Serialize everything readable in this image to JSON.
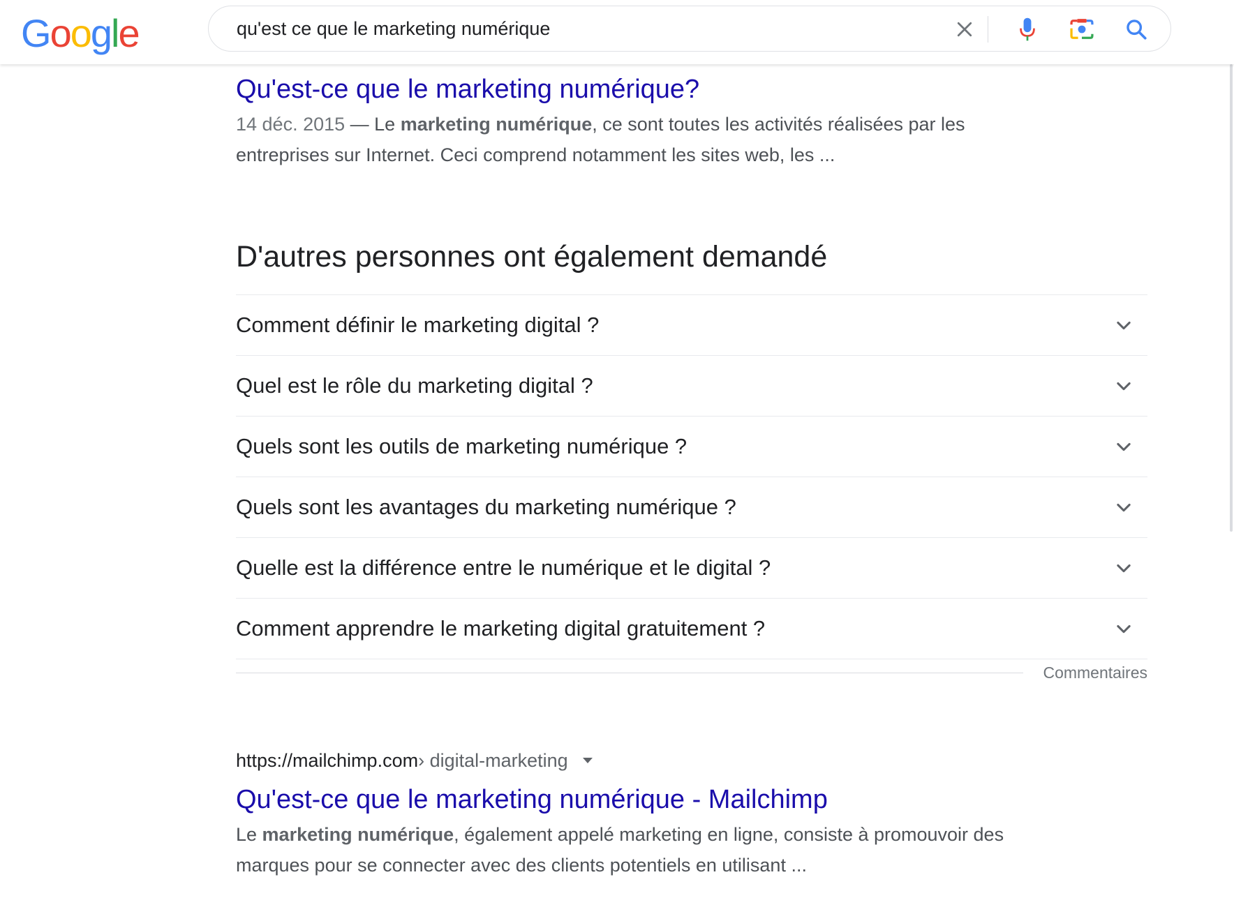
{
  "header": {
    "logo_letters": [
      {
        "ch": "G",
        "color": "#4285F4"
      },
      {
        "ch": "o",
        "color": "#EA4335"
      },
      {
        "ch": "o",
        "color": "#FBBC05"
      },
      {
        "ch": "g",
        "color": "#4285F4"
      },
      {
        "ch": "l",
        "color": "#34A853"
      },
      {
        "ch": "e",
        "color": "#EA4335"
      }
    ],
    "search_value": "qu'est ce que le marketing numérique",
    "icons": [
      "close-icon",
      "microphone-icon",
      "camera-lens-icon",
      "search-icon"
    ]
  },
  "result1": {
    "title": "Qu'est-ce que le marketing numérique?",
    "date": "14 déc. 2015",
    "dash": " — ",
    "snippet_pre": "Le ",
    "snippet_bold": "marketing numérique",
    "snippet_post": ", ce sont toutes les activités réalisées par les entreprises sur Internet. Ceci comprend notamment les sites web, les ..."
  },
  "paa": {
    "heading": "D'autres personnes ont également demandé",
    "questions": [
      "Comment définir le marketing digital ?",
      "Quel est le rôle du marketing digital ?",
      "Quels sont les outils de marketing numérique ?",
      "Quels sont les avantages du marketing numérique ?",
      "Quelle est la différence entre le numérique et le digital ?",
      "Comment apprendre le marketing digital gratuitement ?"
    ],
    "feedback": "Commentaires"
  },
  "result2": {
    "domain": "https://mailchimp.com",
    "path": " › digital-marketing",
    "title": "Qu'est-ce que le marketing numérique - Mailchimp",
    "snippet_pre": "Le ",
    "snippet_bold": "marketing numérique",
    "snippet_post": ", également appelé marketing en ligne, consiste à promouvoir des marques pour se connecter avec des clients potentiels en utilisant ..."
  },
  "colors": {
    "link": "#1a0dab",
    "text": "#202124",
    "snippet": "#4d5156",
    "muted": "#70757a"
  }
}
